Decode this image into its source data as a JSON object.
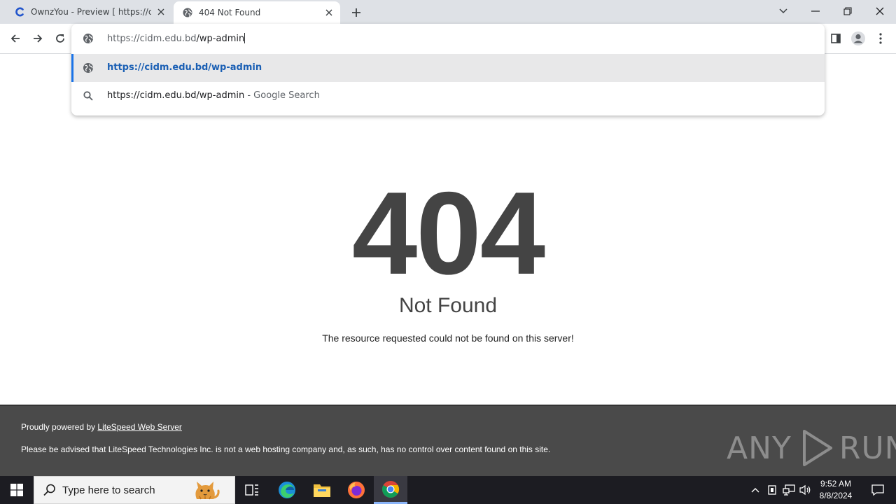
{
  "browser": {
    "tabs": [
      {
        "title": "OwnzYou - Preview [ https://cid",
        "active": false,
        "favicon": "c-logo-icon"
      },
      {
        "title": "404 Not Found",
        "active": true,
        "favicon": "globe-icon"
      }
    ],
    "omnibox": {
      "value_host": "https://cidm.edu.bd",
      "value_path": "/wp-admin",
      "suggestions": [
        {
          "text": "https://cidm.edu.bd/wp-admin",
          "suffix": "",
          "icon": "globe-icon",
          "selected": true
        },
        {
          "text": "https://cidm.edu.bd/wp-admin",
          "suffix": " - Google Search",
          "icon": "search-icon",
          "selected": false
        }
      ]
    }
  },
  "page": {
    "code": "404",
    "title": "Not Found",
    "description": "The resource requested could not be found on this server!",
    "footer": {
      "powered_prefix": "Proudly powered by ",
      "powered_link": "LiteSpeed Web Server",
      "disclaimer": "Please be advised that LiteSpeed Technologies Inc. is not a web hosting company and, as such, has no control over content found on this site."
    }
  },
  "watermark": {
    "left": "ANY",
    "right": "RUN"
  },
  "taskbar": {
    "search_placeholder": "Type here to search",
    "time": "9:52 AM",
    "date": "8/8/2024"
  },
  "colors": {
    "tabstrip_bg": "#dee1e6",
    "accent": "#1a73e8",
    "footer_bg": "#4a4a4a",
    "text_404": "#444444",
    "taskbar_bg": "#1c1c22"
  }
}
